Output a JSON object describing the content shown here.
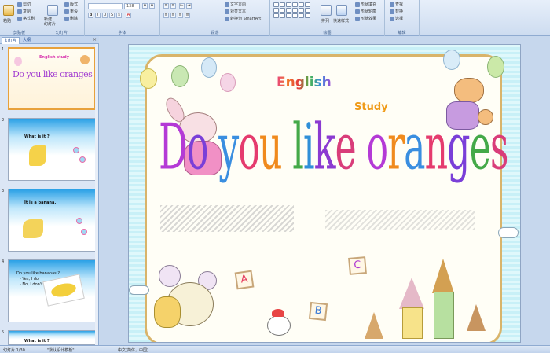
{
  "ribbon": {
    "clipboard": {
      "paste": "粘贴",
      "cut": "剪切",
      "copy": "复制",
      "format_painter": "格式刷",
      "group_label": "剪贴板"
    },
    "slides": {
      "new_slide": "新建\n幻灯片",
      "layout": "版式",
      "reset": "重设",
      "delete": "删除",
      "group_label": "幻灯片"
    },
    "font": {
      "font_name": "",
      "font_size": "138",
      "group_label": "字体"
    },
    "paragraph": {
      "text_direction": "文字方向",
      "align_text": "对齐文本",
      "smartart": "转换为 SmartArt",
      "group_label": "段落"
    },
    "drawing": {
      "arrange": "排列",
      "quick_styles": "快速样式",
      "shape_fill": "形状填充",
      "shape_outline": "形状轮廓",
      "shape_effects": "形状效果",
      "group_label": "绘图"
    },
    "editing": {
      "find": "查找",
      "replace": "替换",
      "select": "选择",
      "group_label": "编辑"
    }
  },
  "pane": {
    "tab_slides": "幻灯片",
    "tab_outline": "大纲",
    "close": "×",
    "thumbs": [
      {
        "num": "1",
        "title": "Do you like oranges ?",
        "label": "English study"
      },
      {
        "num": "2",
        "text": "What is it ?"
      },
      {
        "num": "3",
        "text": "It is a banana."
      },
      {
        "num": "4",
        "text": "Do you like bananas ?",
        "text2": "- Yes, I do.",
        "text3": "- No, I don't."
      },
      {
        "num": "5",
        "text": "What is it ?"
      }
    ]
  },
  "slide": {
    "english": "English",
    "study": "Study",
    "title": "Do you like oranges ?",
    "letters": [
      "A",
      "B",
      "C"
    ]
  },
  "status": {
    "slide_count": "幻灯片 1/30",
    "theme": "\"默认设计模板\"",
    "language": "中文(简体，中国)"
  }
}
